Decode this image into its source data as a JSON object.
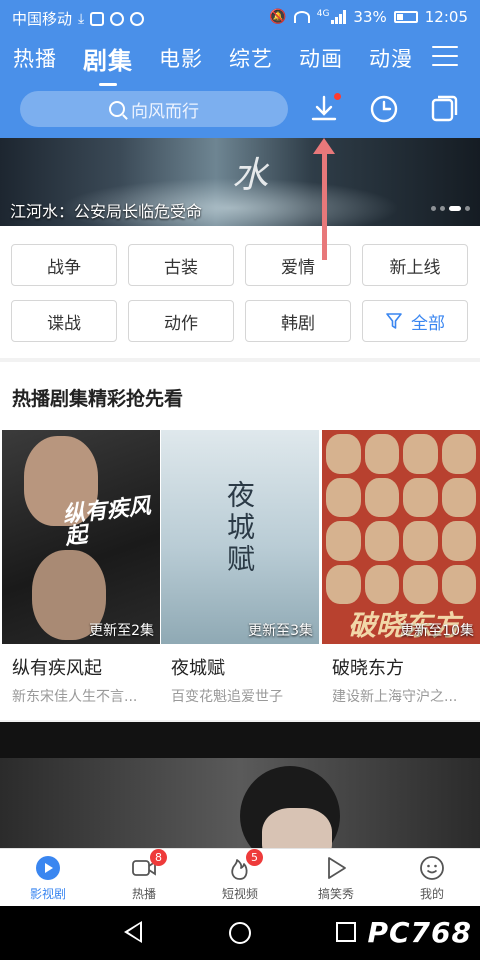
{
  "status_bar": {
    "carrier": "中国移动",
    "network": "4G",
    "battery": "33%",
    "time": "12:05"
  },
  "nav": {
    "tabs": [
      {
        "label": "热播",
        "active": false
      },
      {
        "label": "剧集",
        "active": true
      },
      {
        "label": "电影",
        "active": false
      },
      {
        "label": "综艺",
        "active": false
      },
      {
        "label": "动画",
        "active": false
      },
      {
        "label": "动漫",
        "active": false
      }
    ],
    "menu_icon": "hamburger-icon"
  },
  "search": {
    "placeholder": "向风而行",
    "icons": [
      "download-icon",
      "history-icon",
      "copy-icon"
    ]
  },
  "banner": {
    "caption": "江河水：公安局长临危受命",
    "calligraphy": "水"
  },
  "categories": [
    {
      "label": "战争"
    },
    {
      "label": "古装"
    },
    {
      "label": "爱情"
    },
    {
      "label": "新上线"
    },
    {
      "label": "谍战"
    },
    {
      "label": "动作"
    },
    {
      "label": "韩剧"
    },
    {
      "label": "全部",
      "icon": "filter-icon"
    }
  ],
  "hot_section": {
    "title": "热播剧集精彩抢先看",
    "cards": [
      {
        "title": "纵有疾风起",
        "subtitle": "新东宋佳人生不言...",
        "update": "更新至2集",
        "poster_text": "纵有疾风起"
      },
      {
        "title": "夜城赋",
        "subtitle": "百变花魁追爱世子",
        "update": "更新至3集",
        "poster_text": "夜城赋"
      },
      {
        "title": "破晓东方",
        "subtitle": "建设新上海守沪之...",
        "update": "更新至10集",
        "poster_text": "破晓东方"
      }
    ]
  },
  "tabbar": {
    "items": [
      {
        "label": "影视剧",
        "icon": "play-circle-icon",
        "active": true,
        "badge": ""
      },
      {
        "label": "热播",
        "icon": "video-camera-icon",
        "active": false,
        "badge": "8"
      },
      {
        "label": "短视频",
        "icon": "flame-icon",
        "active": false,
        "badge": "5"
      },
      {
        "label": "搞笑秀",
        "icon": "play-bubble-icon",
        "active": false,
        "badge": ""
      },
      {
        "label": "我的",
        "icon": "smiley-icon",
        "active": false,
        "badge": ""
      }
    ]
  },
  "watermark": "PC768",
  "colors": {
    "primary": "#4a90e9",
    "accent": "#3a86f0",
    "badge": "#ee3b3b",
    "arrow": "#e8787a"
  }
}
